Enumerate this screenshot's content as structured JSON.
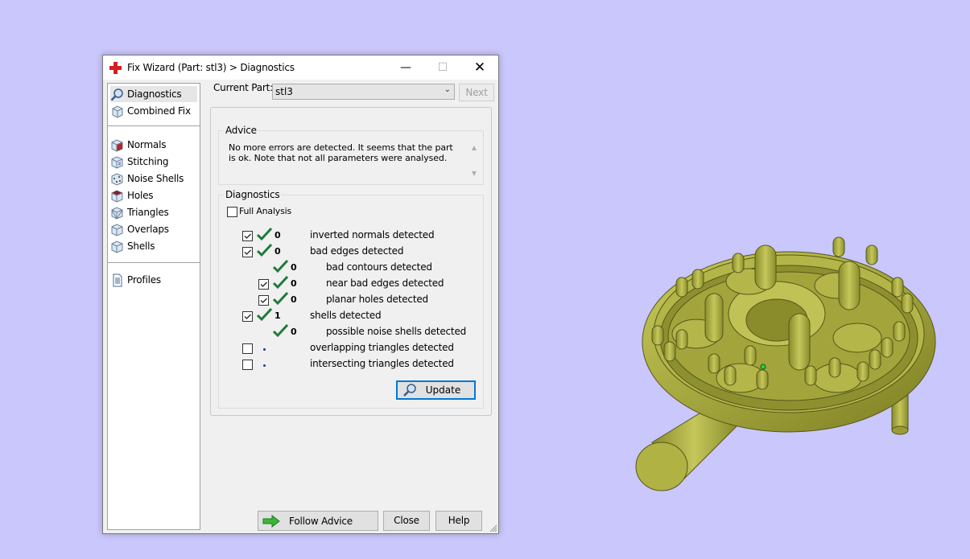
{
  "window": {
    "title": "Fix Wizard (Part: stl3) > Diagnostics",
    "minimize": "—",
    "maximize": "☐",
    "close": "✕"
  },
  "sidebar": {
    "items": [
      {
        "label": "Diagnostics",
        "icon": "magnifier-icon"
      },
      {
        "label": "Combined Fix",
        "icon": "cube-icon"
      },
      {
        "label": "Normals",
        "icon": "normals-cube-icon"
      },
      {
        "label": "Stitching",
        "icon": "stitching-cube-icon"
      },
      {
        "label": "Noise Shells",
        "icon": "noise-shells-icon"
      },
      {
        "label": "Holes",
        "icon": "holes-cube-icon"
      },
      {
        "label": "Triangles",
        "icon": "triangles-cube-icon"
      },
      {
        "label": "Overlaps",
        "icon": "overlaps-cube-icon"
      },
      {
        "label": "Shells",
        "icon": "shells-cube-icon"
      },
      {
        "label": "Profiles",
        "icon": "document-icon"
      }
    ]
  },
  "current_part": {
    "label": "Current Part:",
    "value": "stl3",
    "next_label": "Next"
  },
  "advice": {
    "title": "Advice",
    "text": "No more errors are detected. It seems that the part is ok. Note that not all parameters were analysed."
  },
  "diagnostics": {
    "title": "Diagnostics",
    "full_analysis_label": "Full Analysis",
    "rows": [
      {
        "checked": true,
        "status": "ok",
        "count": "0",
        "text": "inverted normals detected"
      },
      {
        "checked": true,
        "status": "ok",
        "count": "0",
        "text": "bad edges detected"
      },
      {
        "checked": null,
        "status": "ok",
        "count": "0",
        "text": "bad contours detected"
      },
      {
        "checked": true,
        "status": "ok",
        "count": "0",
        "text": "near bad edges detected"
      },
      {
        "checked": true,
        "status": "ok",
        "count": "0",
        "text": "planar holes detected"
      },
      {
        "checked": true,
        "status": "ok",
        "count": "1",
        "text": "shells detected"
      },
      {
        "checked": null,
        "status": "ok",
        "count": "0",
        "text": "possible noise shells detected"
      },
      {
        "checked": false,
        "status": "pending",
        "count": "",
        "text": "overlapping triangles detected"
      },
      {
        "checked": false,
        "status": "pending",
        "count": "",
        "text": "intersecting triangles detected"
      }
    ],
    "update_label": "Update"
  },
  "footer": {
    "follow_advice_label": "Follow Advice",
    "close_label": "Close",
    "help_label": "Help"
  },
  "colors": {
    "background": "#c9c7fb",
    "model": "#a9ab3c",
    "tick_green": "#1f7a3c",
    "focus_blue": "#0078d7"
  }
}
